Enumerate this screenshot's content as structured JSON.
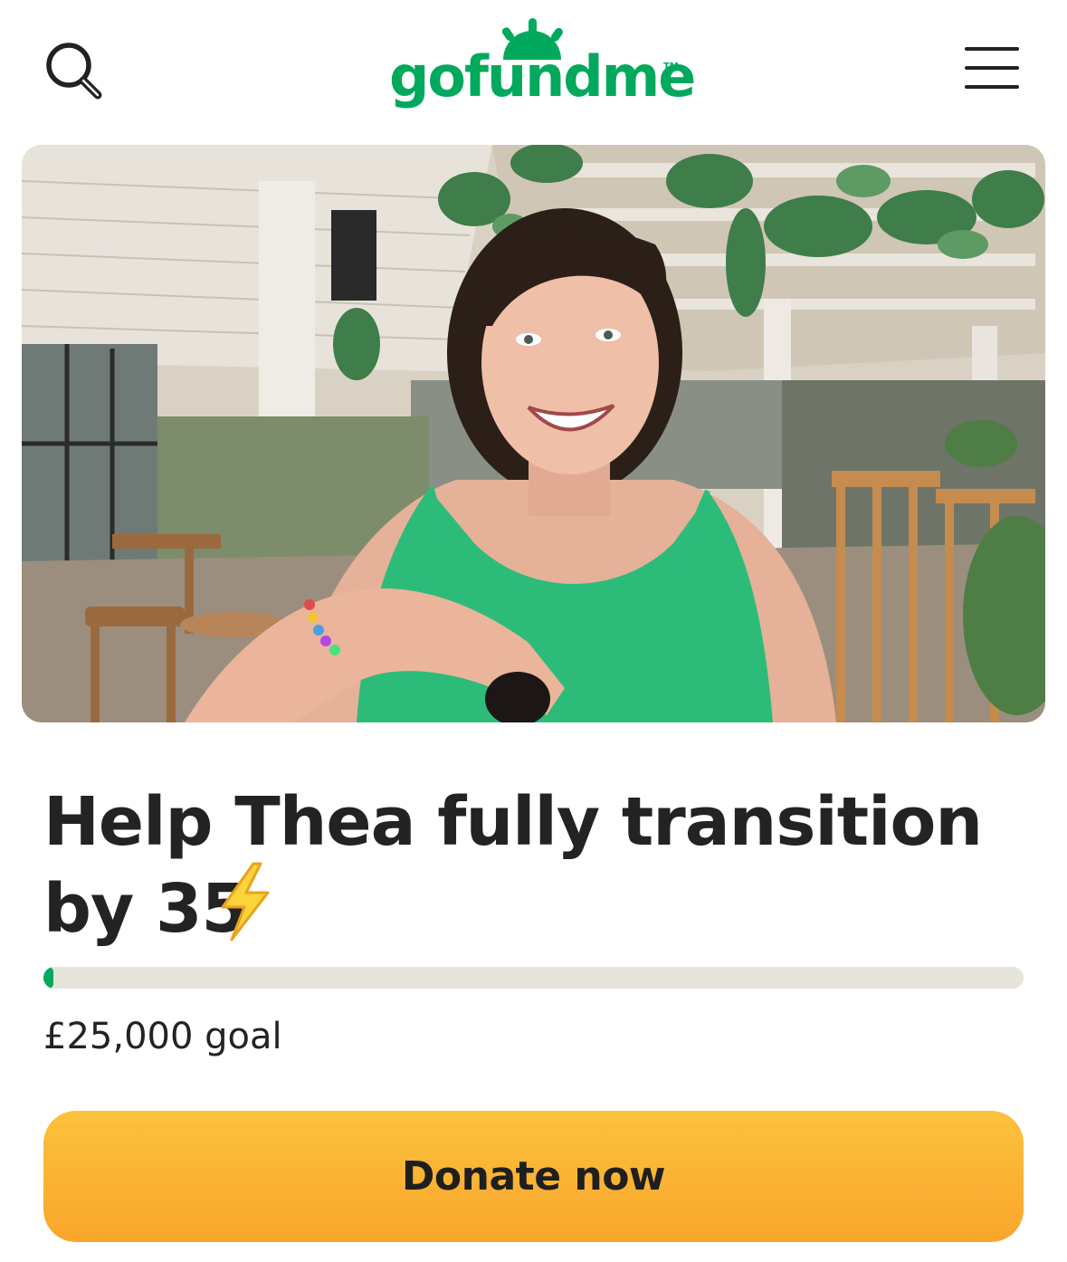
{
  "header": {
    "logo_text": "gofundme",
    "logo_tm": "TM",
    "search_icon": "search-icon",
    "menu_icon": "hamburger-menu-icon"
  },
  "campaign": {
    "title": "Help Thea fully transition by 35",
    "title_emoji": "high-voltage-emoji",
    "progress_fraction": 0.01,
    "goal_text": "£25,000 goal"
  },
  "actions": {
    "donate_label": "Donate now"
  },
  "colors": {
    "brand_green": "#02a95c",
    "donate_orange": "#fbb034",
    "track": "#e7e4dc"
  }
}
